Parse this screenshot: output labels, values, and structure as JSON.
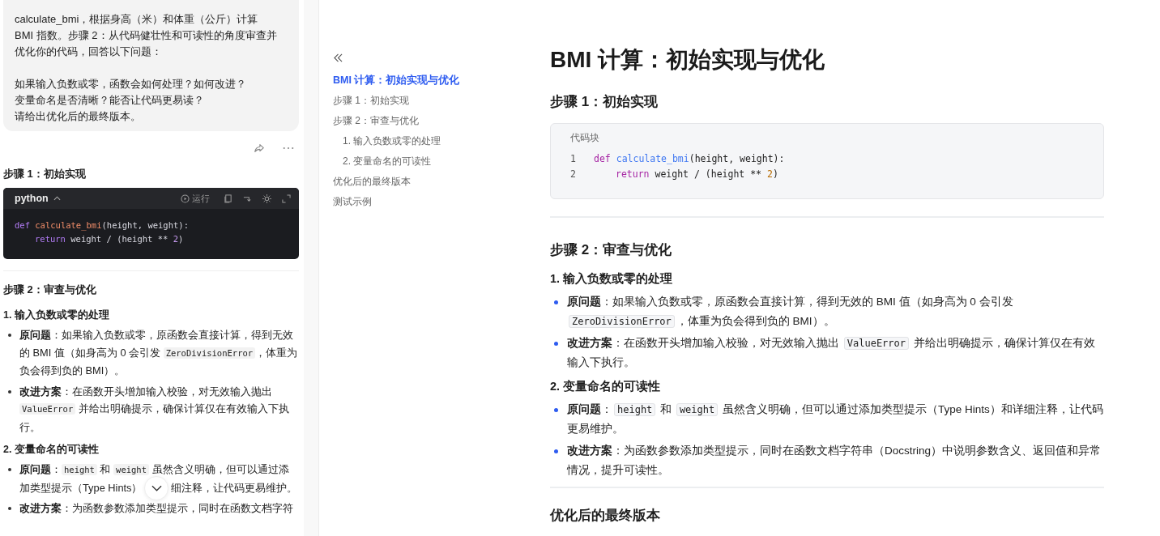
{
  "chat": {
    "prompt_paragraphs": [
      [
        "calculate_bmi，根据身高（米）和体重（公斤）计算",
        "BMI 指数。步骤 2：从代码健壮性和可读性的角度审查并",
        "优化你的代码，回答以下问题："
      ],
      [
        "如果输入负数或零，函数会如何处理？如何改进？",
        "变量命名是否清晰？能否让代码更易读？",
        "请给出优化后的最终版本。"
      ]
    ],
    "step1_heading": "步骤 1：初始实现",
    "code": {
      "language": "python",
      "run_label": "运行",
      "lines": [
        {
          "indented": false,
          "tokens": [
            {
              "kind": "kw",
              "text": "def"
            },
            {
              "kind": "fn",
              "text": " calculate_bmi"
            },
            {
              "kind": "plain",
              "text": "(height, weight):"
            }
          ]
        },
        {
          "indented": true,
          "tokens": [
            {
              "kind": "kw",
              "text": "return"
            },
            {
              "kind": "plain",
              "text": " weight / (height ** "
            },
            {
              "kind": "num",
              "text": "2"
            },
            {
              "kind": "plain",
              "text": ")"
            }
          ]
        }
      ]
    },
    "step2_heading": "步骤 2：审查与优化",
    "sections": [
      {
        "heading": "1. 输入负数或零的处理",
        "bullets": [
          {
            "parts": [
              {
                "kind": "text",
                "text": "**原问题**：如果输入负数或零，原函数会直接计算，得到无效的 BMI 值（如身高为 0 会引发 "
              },
              {
                "kind": "code",
                "text": "ZeroDivisionError"
              },
              {
                "kind": "text",
                "text": "，体重为负会得到负的 BMI）。"
              }
            ]
          },
          {
            "parts": [
              {
                "kind": "text",
                "text": "**改进方案**：在函数开头增加输入校验，对无效输入抛出 "
              },
              {
                "kind": "code",
                "text": "ValueError"
              },
              {
                "kind": "text",
                "text": " 并给出明确提示，确保计算仅在有效输入下执行。"
              }
            ]
          }
        ]
      },
      {
        "heading": "2. 变量命名的可读性",
        "bullets": [
          {
            "parts": [
              {
                "kind": "text",
                "text": "**原问题**："
              },
              {
                "kind": "code",
                "text": "height"
              },
              {
                "kind": "text",
                "text": " 和 "
              },
              {
                "kind": "code",
                "text": "weight"
              },
              {
                "kind": "text",
                "text": " 虽然含义明确，但可以通过添加类型提示（Type Hints）"
              },
              {
                "kind": "covered"
              },
              {
                "kind": "text",
                "text": "细注释，让代码更易维护。"
              }
            ]
          },
          {
            "parts": [
              {
                "kind": "text",
                "text": "**改进方案**：为函数参数添加类型提示，同时在函数文档字符"
              }
            ]
          }
        ]
      }
    ]
  },
  "toc": {
    "items": [
      {
        "label": "BMI 计算：初始实现与优化",
        "selected": true
      },
      {
        "label": "步骤 1：初始实现",
        "selected": false
      },
      {
        "label": "步骤 2：审查与优化",
        "selected": false,
        "children": [
          {
            "label": "1. 输入负数或零的处理",
            "selected": false
          },
          {
            "label": "2. 变量命名的可读性",
            "selected": false
          }
        ]
      },
      {
        "label": "优化后的最终版本",
        "selected": false
      },
      {
        "label": "测试示例",
        "selected": false
      }
    ]
  },
  "document": {
    "title": "BMI 计算：初始实现与优化",
    "step1_heading": "步骤 1：初始实现",
    "code_block": {
      "label": "代码块",
      "lines": [
        {
          "number": "1",
          "indented": false,
          "tokens": [
            {
              "kind": "kw",
              "text": "def"
            },
            {
              "kind": "fn",
              "text": " calculate_bmi"
            },
            {
              "kind": "plain",
              "text": "(height, weight):"
            }
          ]
        },
        {
          "number": "2",
          "indented": true,
          "tokens": [
            {
              "kind": "kw",
              "text": "return"
            },
            {
              "kind": "plain",
              "text": " weight / (height ** "
            },
            {
              "kind": "num",
              "text": "2"
            },
            {
              "kind": "plain",
              "text": ")"
            }
          ]
        }
      ]
    },
    "step2_heading": "步骤 2：审查与优化",
    "sections": [
      {
        "heading": "1. 输入负数或零的处理",
        "bullets": [
          {
            "parts": [
              {
                "kind": "text",
                "text": "**原问题**：如果输入负数或零，原函数会直接计算，得到无效的 BMI 值（如身高为 0 会引发 "
              },
              {
                "kind": "code",
                "text": "ZeroDivisionError"
              },
              {
                "kind": "text",
                "text": "，体重为负会得到负的 BMI）。"
              }
            ]
          },
          {
            "parts": [
              {
                "kind": "text",
                "text": "**改进方案**：在函数开头增加输入校验，对无效输入抛出 "
              },
              {
                "kind": "code",
                "text": "ValueError"
              },
              {
                "kind": "text",
                "text": " 并给出明确提示，确保计算仅在有效输入下执行。"
              }
            ]
          }
        ]
      },
      {
        "heading": "2. 变量命名的可读性",
        "bullets": [
          {
            "parts": [
              {
                "kind": "text",
                "text": "**原问题**："
              },
              {
                "kind": "code",
                "text": "height"
              },
              {
                "kind": "text",
                "text": " 和 "
              },
              {
                "kind": "code",
                "text": "weight"
              },
              {
                "kind": "text",
                "text": " 虽然含义明确，但可以通过添加类型提示（Type Hints）和详细注释，让代码更易维护。"
              }
            ]
          },
          {
            "parts": [
              {
                "kind": "text",
                "text": "**改进方案**：为函数参数添加类型提示，同时在函数文档字符串（Docstring）中说明参数含义、返回值和异常情况，提升可读性。"
              }
            ]
          }
        ]
      }
    ],
    "final_heading": "优化后的最终版本"
  }
}
